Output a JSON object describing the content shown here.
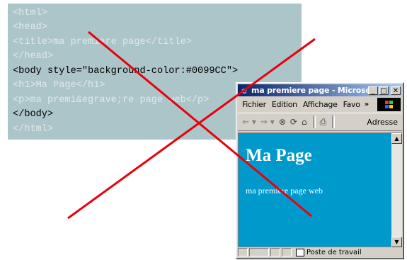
{
  "code_lines": [
    {
      "text": "<html>",
      "highlight": false
    },
    {
      "text": "<head>",
      "highlight": false
    },
    {
      "text": "<title>ma premiere page</title>",
      "highlight": false
    },
    {
      "text": "</head>",
      "highlight": false
    },
    {
      "text": "<body style=\"background-color:#0099CC\">",
      "highlight": true
    },
    {
      "text": "<h1>Ma Page</h1>",
      "highlight": false
    },
    {
      "text": "<p>ma premi&egrave;re page web</p>",
      "highlight": false
    },
    {
      "text": "</body>",
      "highlight": true
    },
    {
      "text": "</html>",
      "highlight": false
    }
  ],
  "browser": {
    "title": "ma premiere page - Microso...",
    "controls": {
      "minimize": "_",
      "maximize": "□",
      "close": "✕"
    },
    "menu": [
      "Fichier",
      "Edition",
      "Affichage",
      "Favo"
    ],
    "menu_more": "»",
    "toolbar_address_label": "Adresse",
    "page": {
      "heading": "Ma Page",
      "paragraph": "ma première page web",
      "background": "#0099cc"
    },
    "status_text": "Poste de travail"
  },
  "colors": {
    "code_bg": "#acc5c8",
    "cross": "#e8000d",
    "titlebar_start": "#0a246a",
    "titlebar_end": "#a6caf0"
  }
}
